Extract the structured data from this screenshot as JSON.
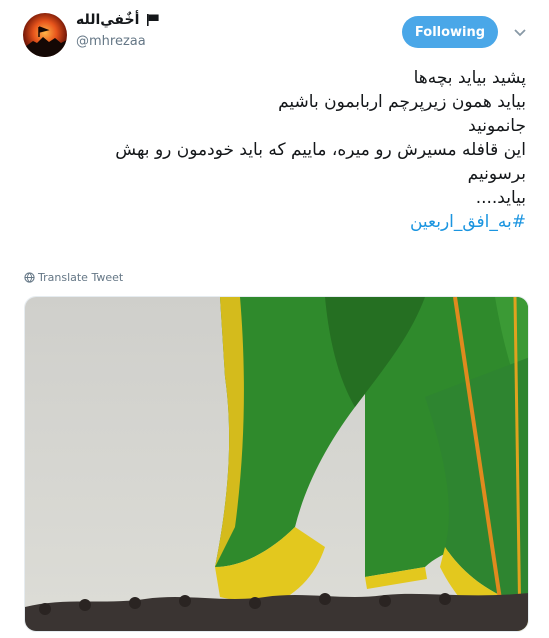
{
  "author": {
    "display_name": "أخٌفي‌الله",
    "handle": "@mhrezaa"
  },
  "follow_button": {
    "label": "Following"
  },
  "tweet": {
    "lines": [
      "پشید بیاید بچه‌ها",
      "بیاید همون زیرپرچم اربابمون باشیم",
      "جانمونید",
      "این قافله مسیرش رو میره، ماییم که باید خودمون رو بهش",
      "برسونیم",
      "بیاید...."
    ],
    "hashtag": "#به_افق_اربعین"
  },
  "translate": {
    "label": "Translate Tweet"
  },
  "icons": {
    "flag": "flag-icon",
    "caret": "chevron-down-icon",
    "globe": "globe-icon"
  },
  "colors": {
    "accent": "#1b95e0",
    "follow_bg": "#4aa7e8",
    "muted": "#657786",
    "flag_green": "#2f8a2c",
    "flag_yellow": "#f2d21a"
  }
}
